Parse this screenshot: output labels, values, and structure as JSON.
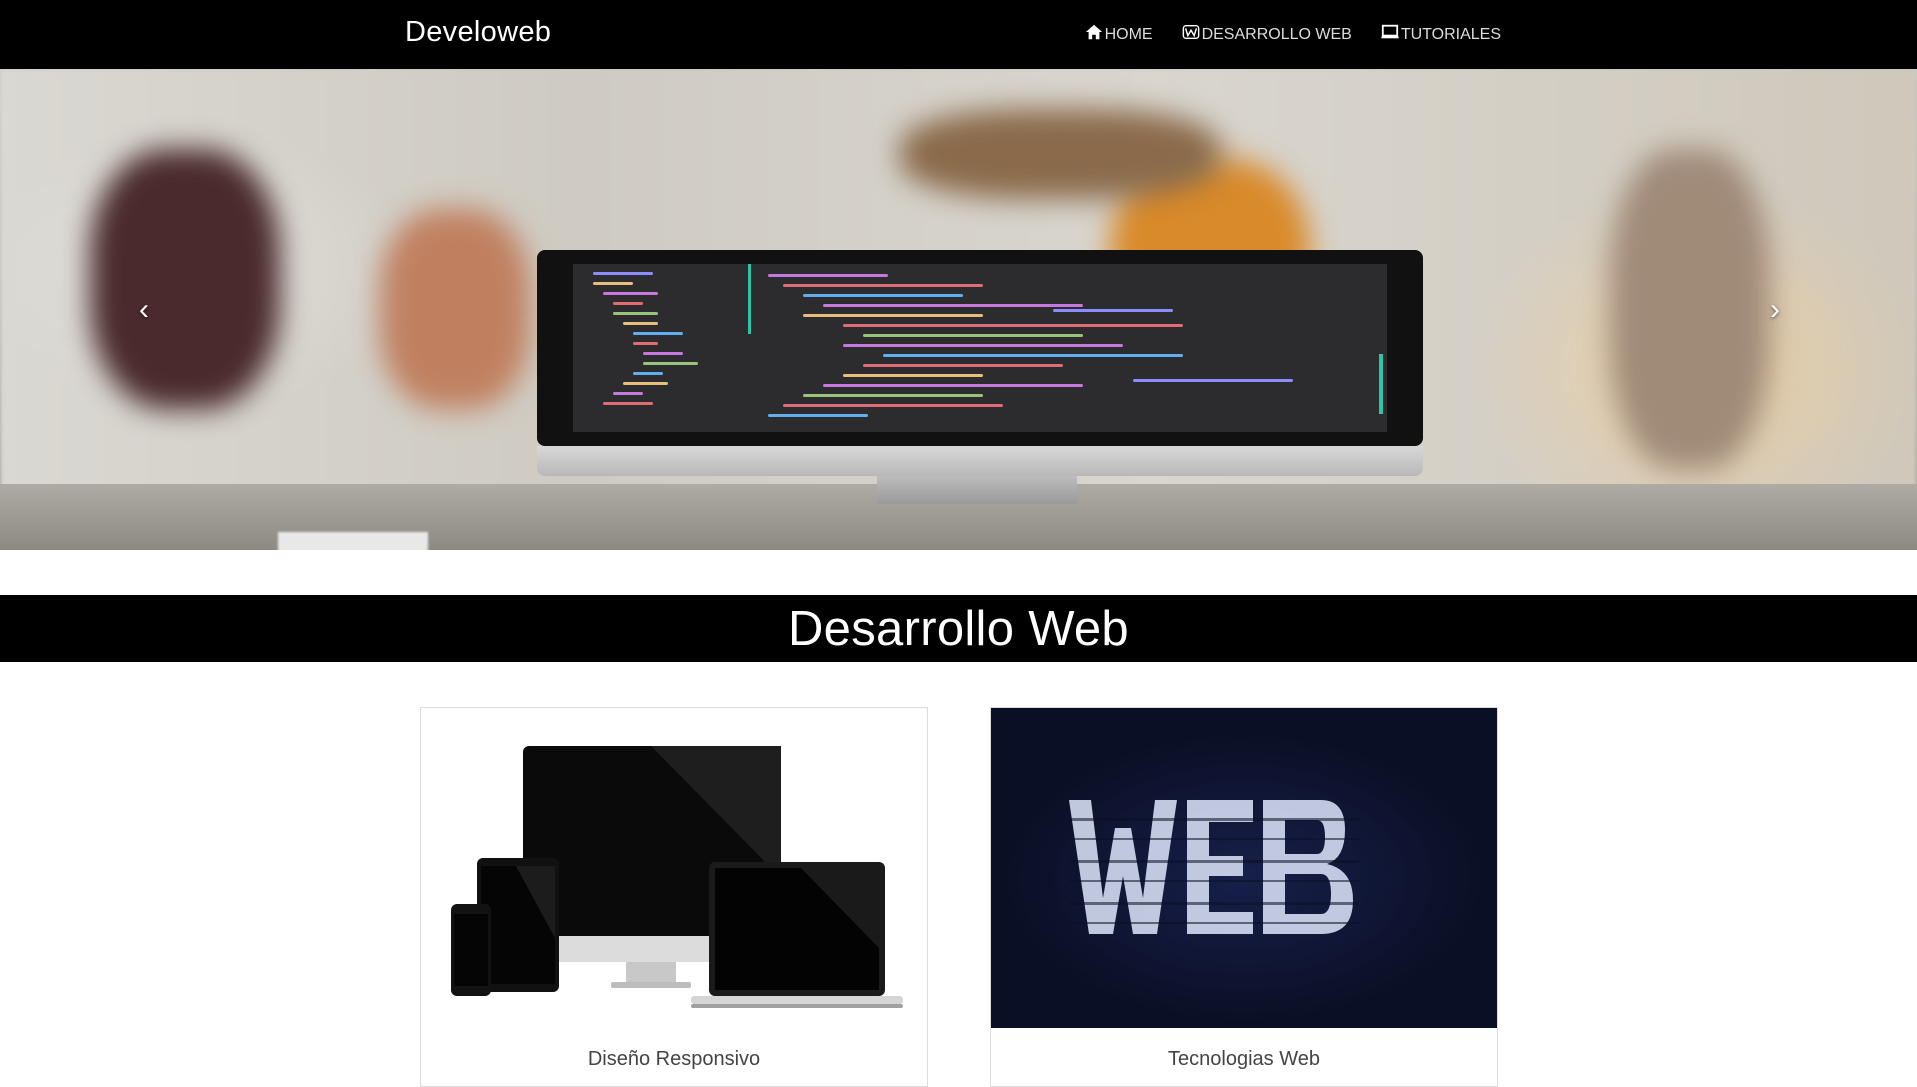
{
  "navbar": {
    "brand": "Develoweb",
    "items": [
      {
        "label": "HOME",
        "icon": "home-icon"
      },
      {
        "label": "DESARROLLO WEB",
        "icon": "w-logo-icon"
      },
      {
        "label": "TUTORIALES",
        "icon": "laptop-icon"
      }
    ]
  },
  "carousel": {
    "prev_icon": "chevron-left-icon",
    "next_icon": "chevron-right-icon",
    "slide_count": 3,
    "active_slide": 1
  },
  "section": {
    "title": "Desarrollo Web"
  },
  "cards": [
    {
      "caption": "Diseño Responsivo"
    },
    {
      "caption": "Tecnologias Web"
    }
  ],
  "colors": {
    "navbar_bg": "#000000",
    "section_bar_bg": "#000000",
    "card2_bg": "#0b0f25"
  }
}
